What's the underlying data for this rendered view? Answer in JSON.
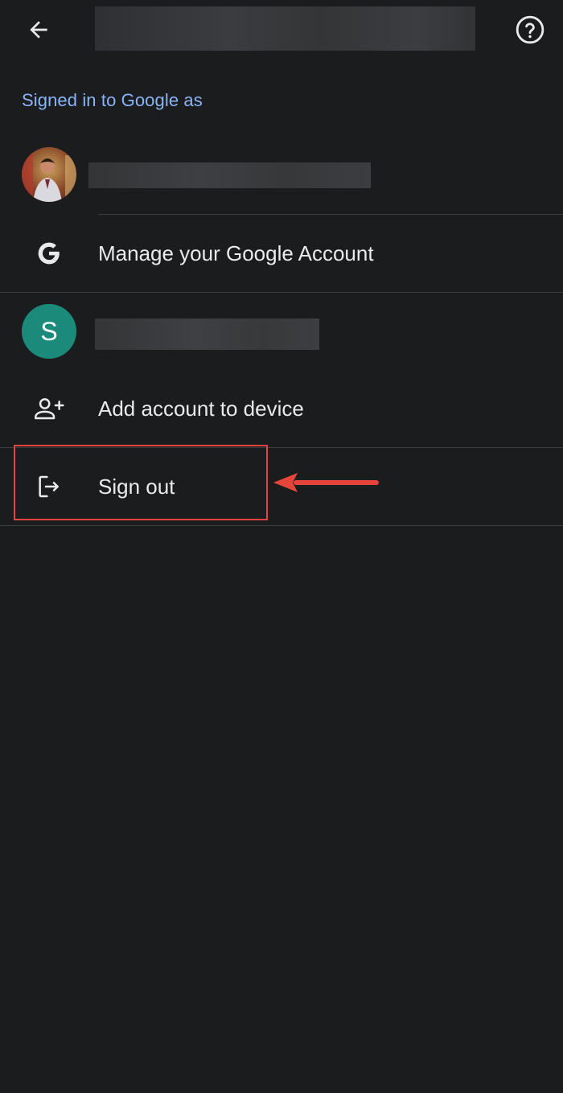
{
  "header": {
    "back_icon": "arrow-back-icon",
    "help_icon": "help-circle-icon"
  },
  "section_label": "Signed in to Google as",
  "primary_account": {
    "avatar": "profile-photo",
    "manage_label": "Manage your Google Account",
    "manage_icon": "google-g-icon"
  },
  "secondary_account": {
    "avatar_initial": "S",
    "avatar_color": "#1c8a7a"
  },
  "actions": {
    "add_account_label": "Add account to device",
    "add_account_icon": "person-add-icon",
    "sign_out_label": "Sign out",
    "sign_out_icon": "logout-icon"
  },
  "annotation": {
    "highlight_color": "#e5443b"
  },
  "colors": {
    "background": "#1b1c1e",
    "accent": "#8ab4f8",
    "text": "#e8eaed",
    "divider": "#3c3e41"
  }
}
